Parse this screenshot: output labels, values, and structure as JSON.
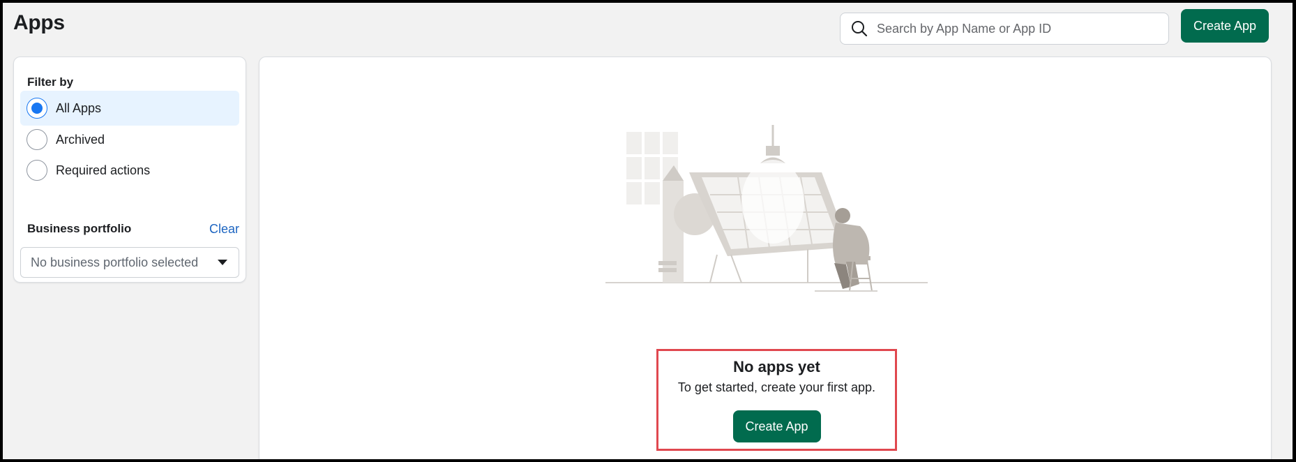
{
  "page": {
    "title": "Apps"
  },
  "search": {
    "placeholder": "Search by App Name or App ID"
  },
  "header": {
    "create_label": "Create App"
  },
  "filters": {
    "heading": "Filter by",
    "options": [
      {
        "label": "All Apps",
        "selected": true
      },
      {
        "label": "Archived",
        "selected": false
      },
      {
        "label": "Required actions",
        "selected": false
      }
    ]
  },
  "business_portfolio": {
    "heading": "Business portfolio",
    "clear_label": "Clear",
    "selected_value": "No business portfolio selected"
  },
  "empty_state": {
    "title": "No apps yet",
    "subtitle": "To get started, create your first app.",
    "create_label": "Create App"
  },
  "colors": {
    "primary": "#016b4e",
    "link": "#1d65c1",
    "highlight": "#e0484f",
    "selected_bg": "#e7f3ff"
  },
  "icons": [
    "search-icon",
    "chevron-down-icon",
    "empty-state-illustration"
  ]
}
